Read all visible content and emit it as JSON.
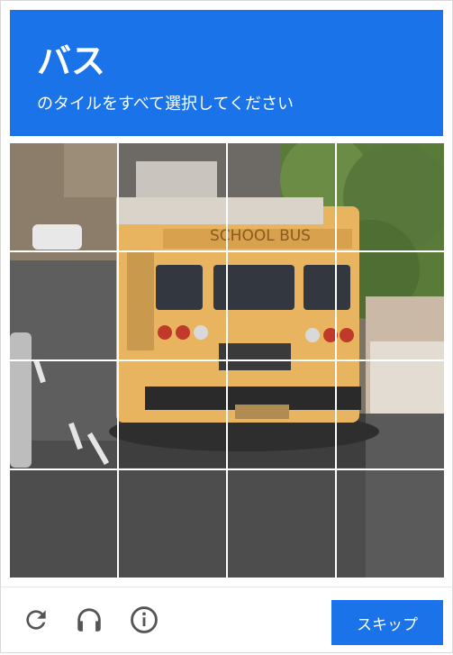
{
  "header": {
    "title": "バス",
    "subtitle": "のタイルをすべて選択してください"
  },
  "grid": {
    "rows": 4,
    "cols": 4,
    "bus_text": "SCHOOL BUS"
  },
  "footer": {
    "skip_label": "スキップ",
    "icons": [
      "reload-icon",
      "headphones-icon",
      "info-icon"
    ]
  },
  "colors": {
    "accent": "#1a73e8",
    "icon": "#555555"
  }
}
